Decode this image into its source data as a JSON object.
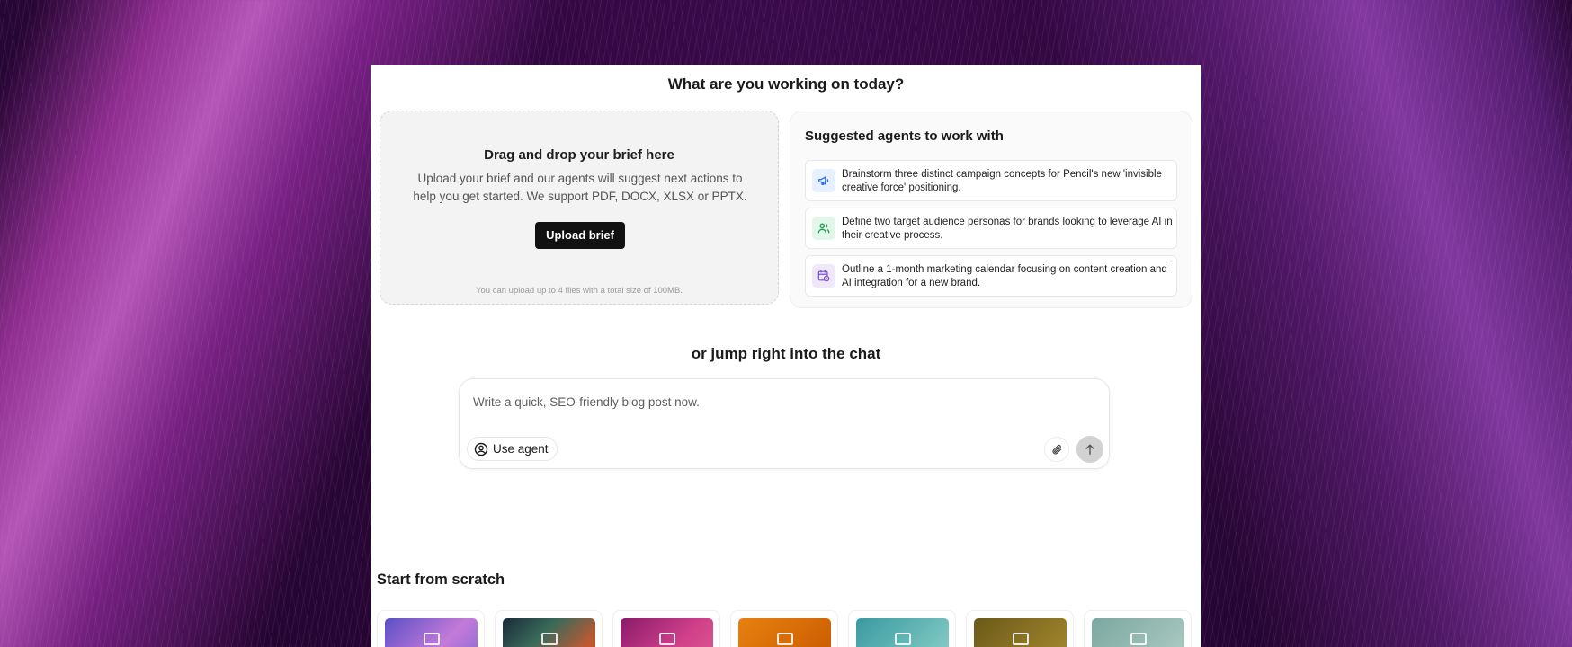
{
  "main": {
    "title": "What are you working on today?"
  },
  "upload": {
    "title": "Drag and drop your brief here",
    "description": "Upload your brief and our agents will suggest next actions to help you get started. We support PDF, DOCX, XLSX or PPTX.",
    "button_label": "Upload brief",
    "note": "You can upload up to 4 files with a total size of 100MB."
  },
  "suggested": {
    "title": "Suggested agents to work with",
    "items": [
      {
        "icon": "megaphone-icon",
        "text": "Brainstorm three distinct campaign concepts for Pencil's new 'invisible creative force' positioning.",
        "color": "#2f6df6"
      },
      {
        "icon": "users-icon",
        "text": "Define two target audience personas for brands looking to leverage AI in their creative process.",
        "color": "#1f9d55"
      },
      {
        "icon": "calendar-clock-icon",
        "text": "Outline a 1-month marketing calendar focusing on content creation and AI integration for a new brand.",
        "color": "#7b4fd6"
      }
    ]
  },
  "chat": {
    "title": "or jump right into the chat",
    "placeholder": "Write a quick, SEO-friendly blog post now.",
    "use_agent_label": "Use agent"
  },
  "scratch": {
    "title": "Start from scratch",
    "tiles": [
      {
        "icon": "image-icon",
        "colors": [
          "#6a5bd6",
          "#c07ad8"
        ]
      },
      {
        "icon": "frame-icon",
        "colors": [
          "#1e2a3a",
          "#c0582f"
        ]
      },
      {
        "icon": "video-icon",
        "colors": [
          "#a0287a",
          "#e05090"
        ]
      },
      {
        "icon": "document-icon",
        "colors": [
          "#e07010",
          "#c85a00"
        ]
      },
      {
        "icon": "layout-icon",
        "colors": [
          "#4aa6a8",
          "#8ad0c8"
        ]
      },
      {
        "icon": "layout-icon",
        "colors": [
          "#7a6a20",
          "#a88a30"
        ]
      },
      {
        "icon": "mail-icon",
        "colors": [
          "#8ab0a8",
          "#a8c4bc"
        ]
      }
    ]
  }
}
